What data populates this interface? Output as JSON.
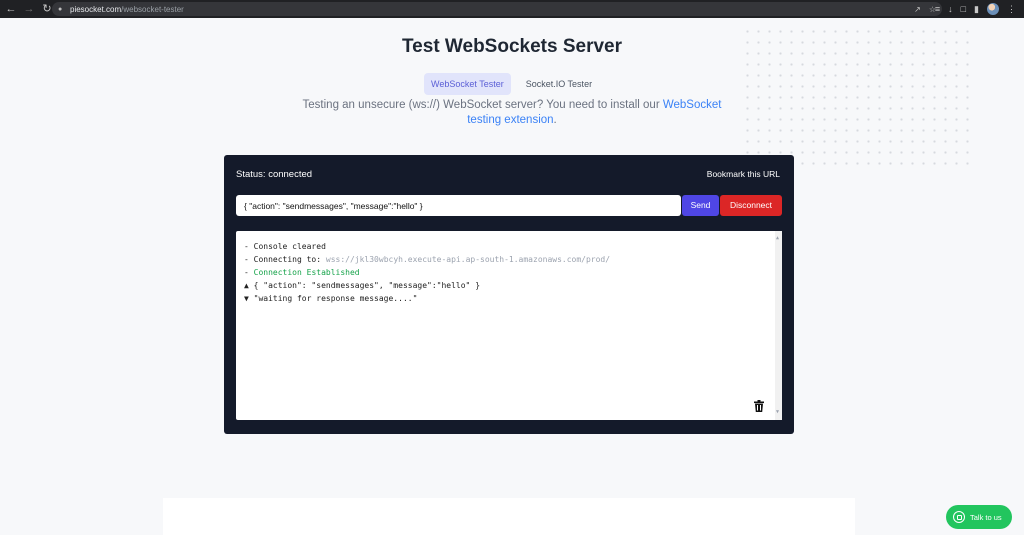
{
  "browser": {
    "back_icon": "arrow-left-icon",
    "forward_icon": "arrow-right-icon",
    "reload_icon": "reload-icon",
    "url_domain": "piesocket.com",
    "url_path": "/websocket-tester"
  },
  "page": {
    "title": "Test WebSockets Server",
    "tabs": [
      {
        "label": "WebSocket Tester",
        "active": true
      },
      {
        "label": "Socket.IO Tester",
        "active": false
      }
    ],
    "info_prefix": "Testing an unsecure (ws://) WebSocket server? You need to install our ",
    "info_link": "WebSocket testing extension",
    "info_suffix": "."
  },
  "tester": {
    "status_text": "Status: connected",
    "bookmark_label": "Bookmark this URL",
    "message_value": "{ \"action\": \"sendmessages\", \"message\":\"hello\" }",
    "send_label": "Send",
    "disconnect_label": "Disconnect",
    "console": [
      {
        "prefix": "- Console cleared",
        "rest": ""
      },
      {
        "prefix": "- Connecting to: ",
        "rest": "wss://jkl30wbcyh.execute-api.ap-south-1.amazonaws.com/prod/"
      },
      {
        "prefix": "- ",
        "rest": "Connection Established"
      },
      {
        "prefix": "▲ { \"action\": \"sendmessages\", \"message\":\"hello\" }",
        "rest": ""
      },
      {
        "prefix": "▼ \"waiting for response message....\"",
        "rest": ""
      }
    ]
  },
  "widget": {
    "talk_label": "Talk to us"
  },
  "colors": {
    "panel_bg": "#141a2a",
    "send": "#4f46e5",
    "disconnect": "#dc2626",
    "link": "#3b82f6",
    "success": "#16a34a",
    "whatsapp": "#22c55e"
  }
}
